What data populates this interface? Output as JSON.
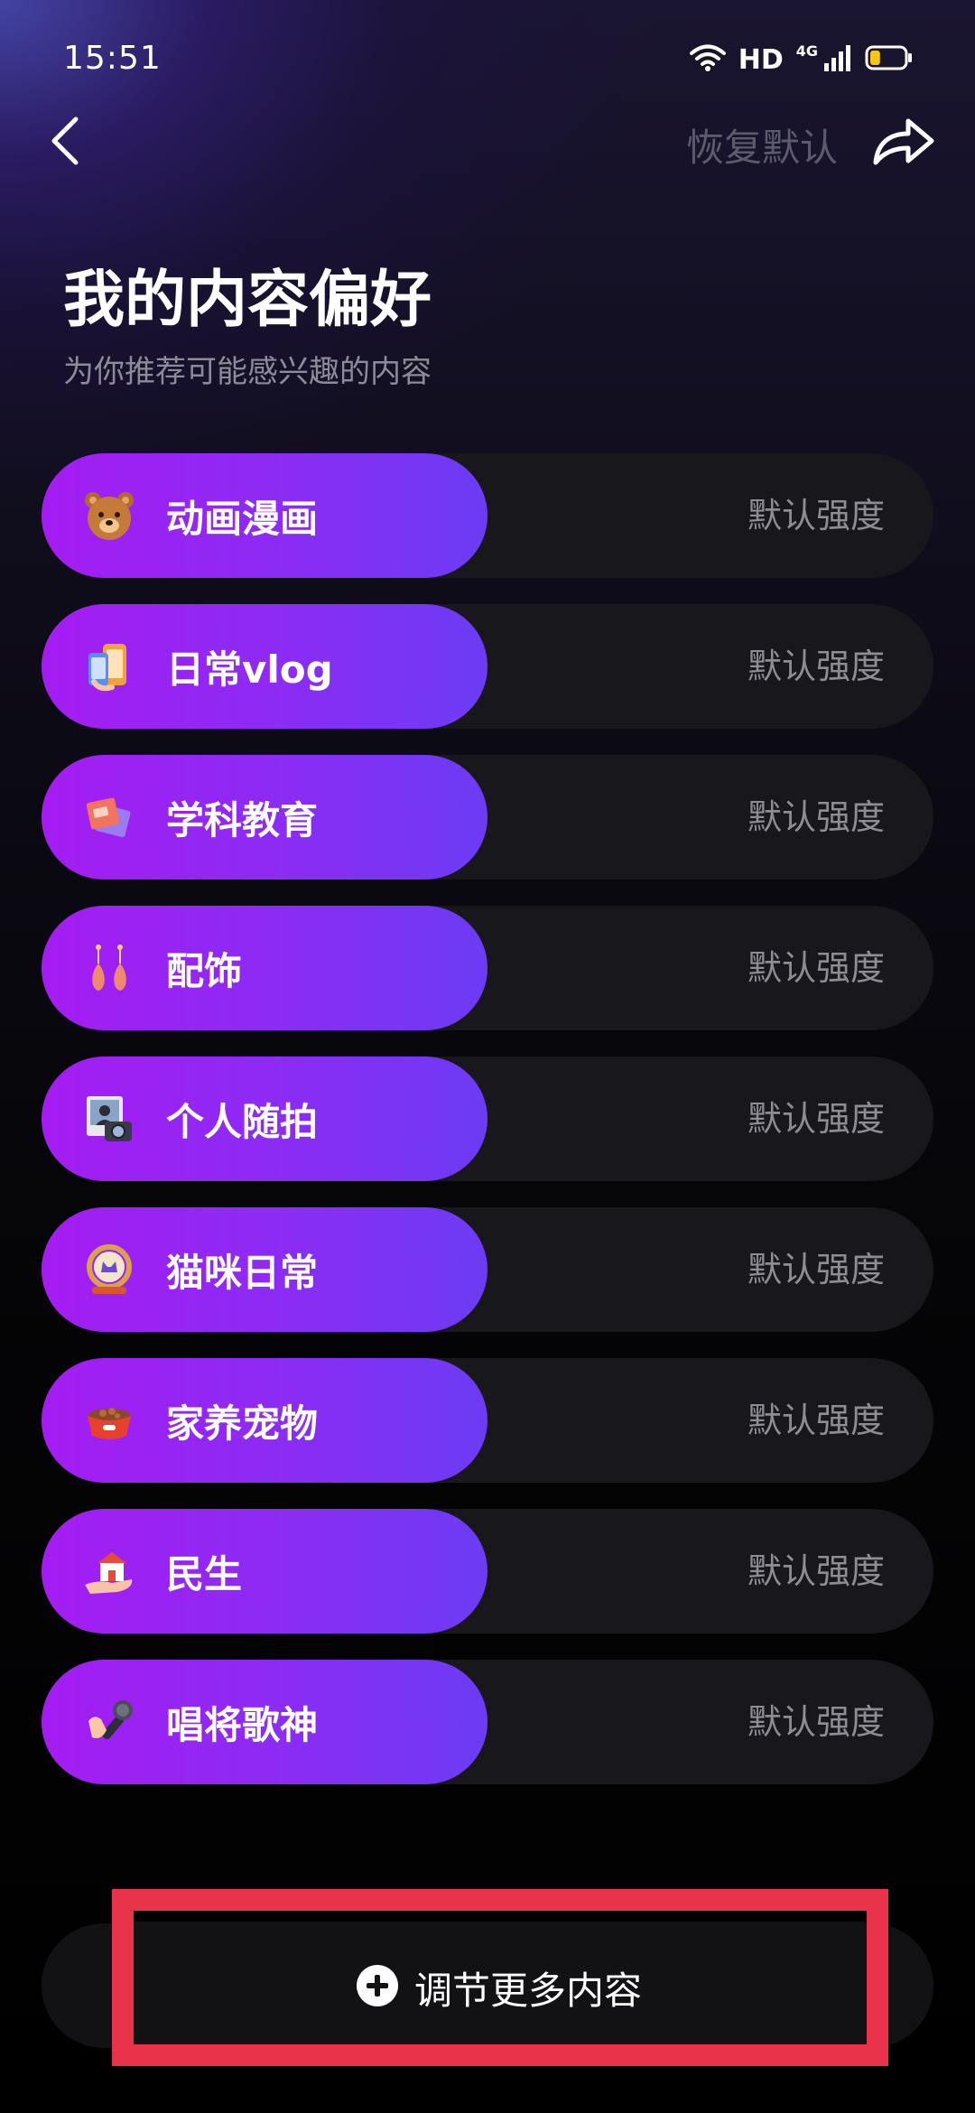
{
  "status_bar": {
    "time": "15:51",
    "hd": "HD",
    "network": "4G",
    "battery_level": 0.3,
    "battery_color": "#f5c518"
  },
  "header": {
    "restore_default": "恢复默认",
    "back_icon": "chevron-left-icon",
    "share_icon": "share-arrow-icon"
  },
  "page": {
    "title": "我的内容偏好",
    "subtitle": "为你推荐可能感兴趣的内容"
  },
  "preferences": [
    {
      "label": "动画漫画",
      "strength": "默认强度",
      "icon": "bear-icon"
    },
    {
      "label": "日常vlog",
      "strength": "默认强度",
      "icon": "phone-vlog-icon"
    },
    {
      "label": "学科教育",
      "strength": "默认强度",
      "icon": "books-icon"
    },
    {
      "label": "配饰",
      "strength": "默认强度",
      "icon": "earrings-icon"
    },
    {
      "label": "个人随拍",
      "strength": "默认强度",
      "icon": "camera-photo-icon"
    },
    {
      "label": "猫咪日常",
      "strength": "默认强度",
      "icon": "cat-mirror-icon"
    },
    {
      "label": "家养宠物",
      "strength": "默认强度",
      "icon": "pet-bowl-icon"
    },
    {
      "label": "民生",
      "strength": "默认强度",
      "icon": "house-hand-icon"
    },
    {
      "label": "唱将歌神",
      "strength": "默认强度",
      "icon": "microphone-hand-icon"
    }
  ],
  "more": {
    "label": "调节更多内容",
    "icon": "plus-circle-icon"
  },
  "colors": {
    "pill_start": "#a51cf2",
    "pill_end": "#6c3cf5",
    "highlight": "#e9334b"
  }
}
